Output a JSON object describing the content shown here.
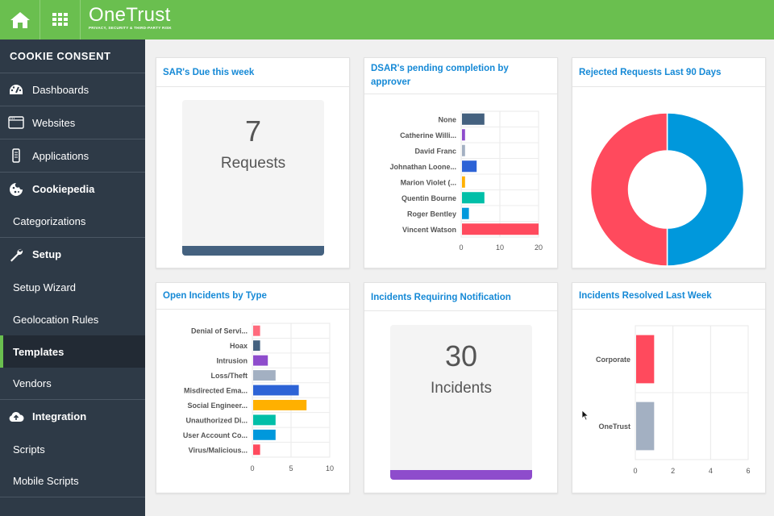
{
  "header": {
    "brand_name": "OneTrust",
    "brand_tagline": "PRIVACY, SECURITY & THIRD-PARTY RISK",
    "home_icon": "home-icon",
    "apps_icon": "grid-icon",
    "color": "#6abf4f"
  },
  "sidebar": {
    "section_title": "COOKIE CONSENT",
    "items": [
      {
        "label": "Dashboards",
        "icon": "gauge-icon"
      },
      {
        "label": "Websites",
        "icon": "browser-window-icon"
      },
      {
        "label": "Applications",
        "icon": "mobile-icon"
      },
      {
        "label": "Cookiepedia",
        "icon": "cookie-icon"
      },
      {
        "label": "Categorizations"
      },
      {
        "label": "Setup",
        "icon": "wrench-icon"
      },
      {
        "label": "Setup Wizard"
      },
      {
        "label": "Geolocation Rules"
      },
      {
        "label": "Templates",
        "active": true
      },
      {
        "label": "Vendors"
      },
      {
        "label": "Integration",
        "icon": "cloud-icon"
      },
      {
        "label": "Scripts"
      },
      {
        "label": "Mobile Scripts"
      }
    ]
  },
  "cards": {
    "sar_due": {
      "title": "SAR's Due this week",
      "value": "7",
      "label": "Requests",
      "color": "#44617f"
    },
    "dsar_pending": {
      "title": "DSAR's pending completion by approver"
    },
    "rejected": {
      "title": "Rejected Requests Last 90 Days"
    },
    "open_incidents": {
      "title": "Open Incidents by Type"
    },
    "incidents_notification": {
      "title": "Incidents Requiring Notification",
      "value": "30",
      "label": "Incidents",
      "color": "#8e4ccc"
    },
    "incidents_resolved": {
      "title": "Incidents Resolved Last Week"
    }
  },
  "chart_data": [
    {
      "id": "dsar",
      "type": "bar",
      "orientation": "horizontal",
      "title": "DSAR's pending completion by approver",
      "categories": [
        "None",
        "Catherine Willi...",
        "David Franc",
        "Johnathan Loone...",
        "Marion Violet (...",
        "Quentin Bourne",
        "Roger Bentley",
        "Vincent Watson"
      ],
      "values": [
        6,
        1,
        1,
        4,
        1,
        6,
        2,
        20
      ],
      "colors": [
        "#44617f",
        "#8e4ccc",
        "#a3b0c2",
        "#2d63d6",
        "#ffb000",
        "#00bfa8",
        "#0098dc",
        "#ff4a5d"
      ],
      "xlim": [
        0,
        20
      ],
      "xticks": [
        "0",
        "10",
        "20"
      ],
      "grid": true
    },
    {
      "id": "rejected",
      "type": "pie",
      "donut": true,
      "title": "Rejected Requests Last 90 Days",
      "values": [
        50,
        50
      ],
      "colors": [
        "#0098dc",
        "#ff4a5d"
      ]
    },
    {
      "id": "incidents_type",
      "type": "bar",
      "orientation": "horizontal",
      "title": "Open Incidents by Type",
      "categories": [
        "Denial of Servi...",
        "Hoax",
        "Intrusion",
        "Loss/Theft",
        "Misdirected Ema...",
        "Social Engineer...",
        "Unauthorized Di...",
        "User Account Co...",
        "Virus/Malicious..."
      ],
      "values": [
        1,
        1,
        2,
        3,
        6,
        7,
        3,
        3,
        1
      ],
      "colors": [
        "#ff6b7d",
        "#44617f",
        "#8e4ccc",
        "#a3b0c2",
        "#2d63d6",
        "#ffb000",
        "#00bfa8",
        "#0098dc",
        "#ff4a5d"
      ],
      "xlim": [
        0,
        10
      ],
      "xticks": [
        "0",
        "5",
        "10"
      ],
      "grid": true
    },
    {
      "id": "resolved",
      "type": "bar",
      "orientation": "horizontal",
      "title": "Incidents Resolved Last Week",
      "categories": [
        "Corporate",
        "OneTrust"
      ],
      "values": [
        1,
        1
      ],
      "colors": [
        "#ff4a5d",
        "#a3b0c2"
      ],
      "xlim": [
        0,
        6
      ],
      "xticks": [
        "0",
        "2",
        "4",
        "6"
      ],
      "grid": true
    }
  ]
}
